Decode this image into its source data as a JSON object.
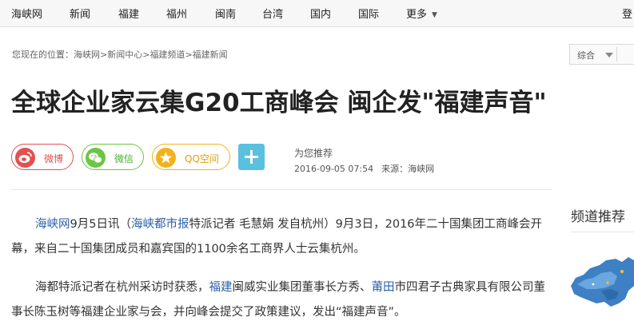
{
  "nav": {
    "items": [
      "海峡网",
      "新闻",
      "福建",
      "福州",
      "闽南",
      "台湾",
      "国内",
      "国际",
      "更多"
    ],
    "login": "登"
  },
  "breadcrumb": {
    "prefix": "您现在的位置：",
    "items": [
      "海峡网",
      "新闻中心",
      "福建频道",
      "福建新闻"
    ],
    "separator": ">"
  },
  "search": {
    "selected": "综合"
  },
  "article": {
    "title": "全球企业家云集G20工商峰会 闽企发\"福建声音\"",
    "recommend": "为您推荐",
    "datetime": "2016-09-05 07:54",
    "source": "来源：海峡网"
  },
  "share": {
    "weibo": "微博",
    "weixin": "微信",
    "qq": "QQ空间"
  },
  "body": {
    "p1": {
      "link1": "海峡网",
      "t1": "9月5日讯（",
      "link2": "海峡都市报",
      "t2": "特派记者 毛慧娟 发自杭州）9月3日，2016年二十国集团工商峰会开幕，来自二十国集团成员和嘉宾国的1100余名工商界人士云集杭州。"
    },
    "p2": {
      "t1": "海都特派记者在杭州采访时获悉，",
      "link1": "福建",
      "t2": "闽威实业集团董事长方秀、",
      "link2": "莆田",
      "t3": "市四君子古典家具有限公司董事长陈玉树等福建企业家与会，并向峰会提交了政策建议，发出“福建声音”。"
    }
  },
  "sidebar": {
    "title": "频道推荐"
  },
  "colors": {
    "weibo": "#e25050",
    "weixin": "#6cc644",
    "qq": "#f2b21b",
    "plus": "#5bc0de",
    "link": "#2b5fa8"
  }
}
